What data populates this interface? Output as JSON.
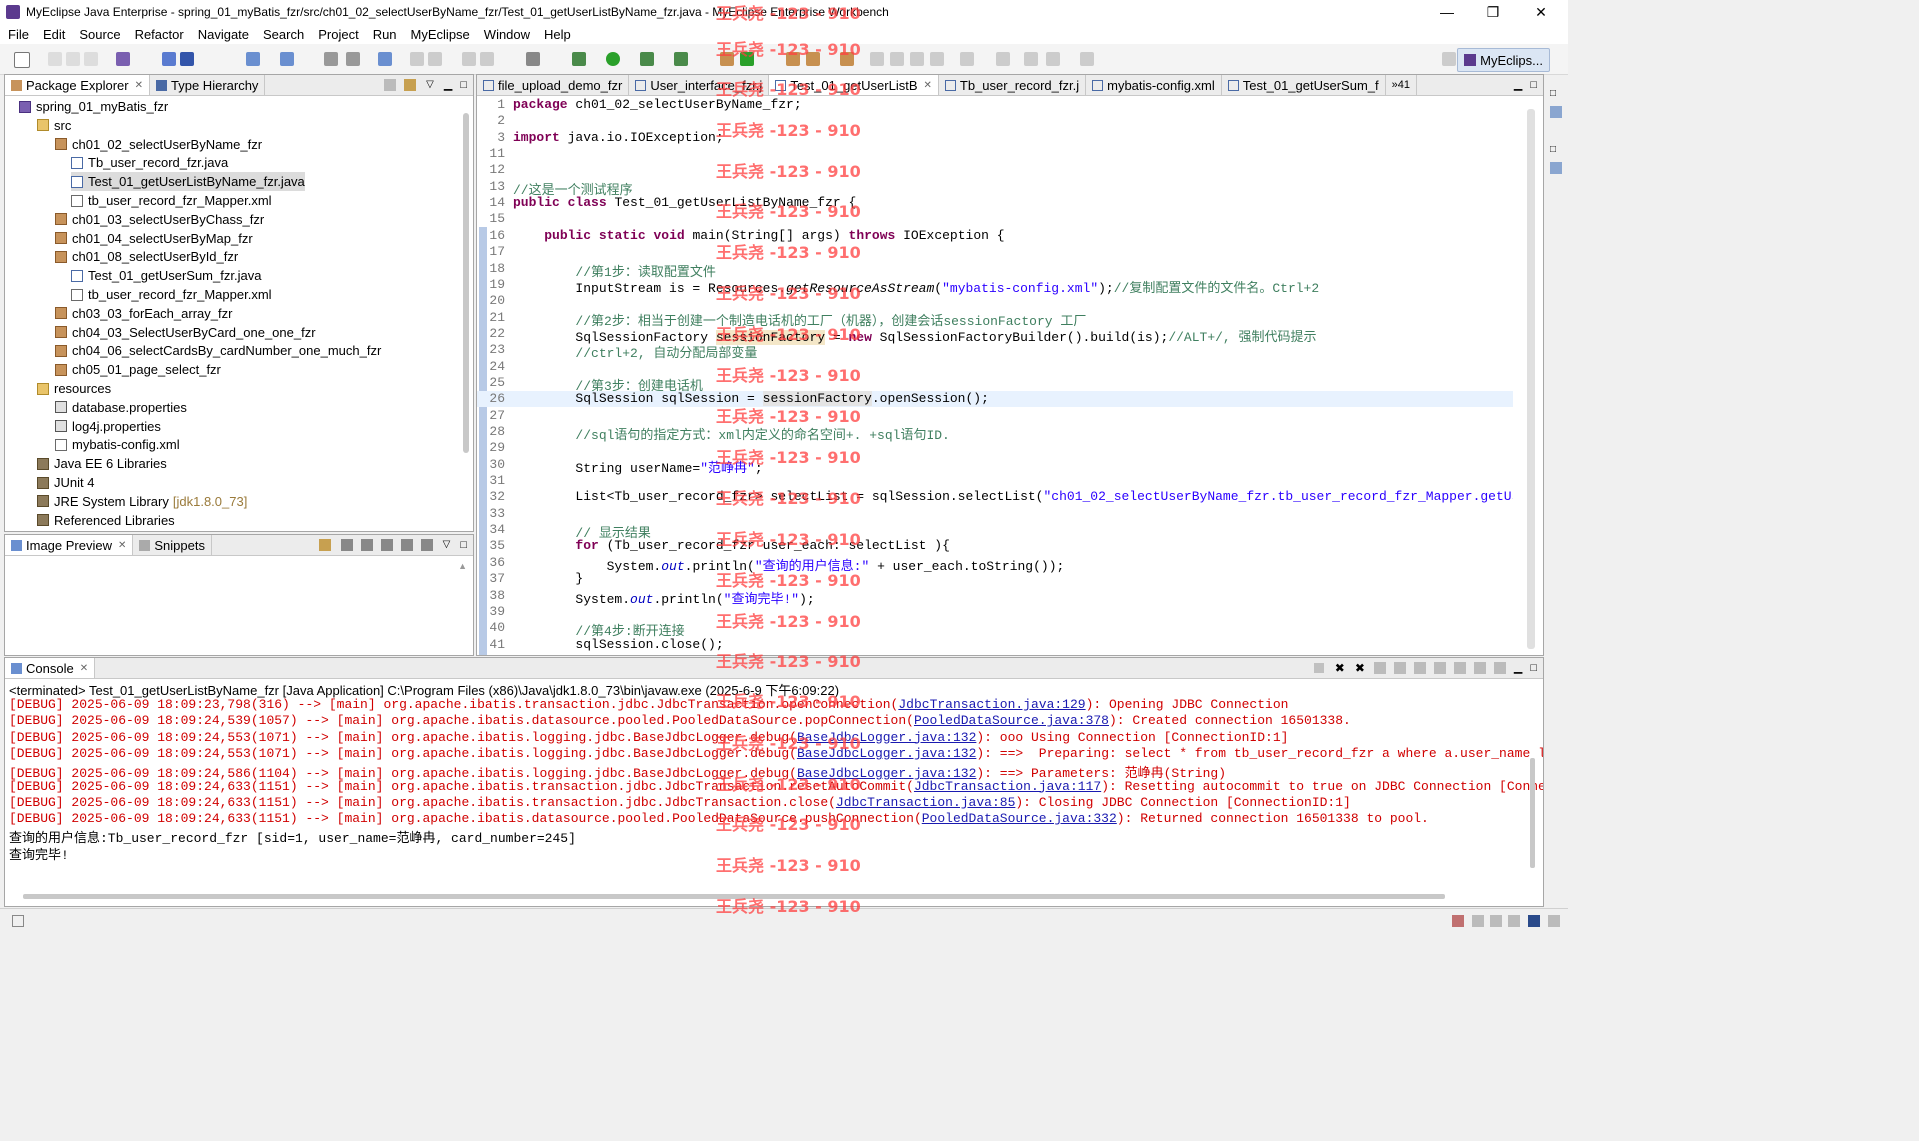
{
  "window": {
    "title": "MyEclipse Java Enterprise - spring_01_myBatis_fzr/src/ch01_02_selectUserByName_fzr/Test_01_getUserListByName_fzr.java - MyEclipse Enterprise Workbench",
    "minimize": "—",
    "maximize": "❐",
    "close": "✕"
  },
  "menu": [
    "File",
    "Edit",
    "Source",
    "Refactor",
    "Navigate",
    "Search",
    "Project",
    "Run",
    "MyEclipse",
    "Window",
    "Help"
  ],
  "perspective": "MyEclips...",
  "package_explorer": {
    "tab": "Package Explorer",
    "tab2": "Type Hierarchy",
    "items": [
      {
        "label": "spring_01_myBatis_fzr",
        "kind": "project",
        "level": 0
      },
      {
        "label": "src",
        "kind": "folder",
        "level": 1
      },
      {
        "label": "ch01_02_selectUserByName_fzr",
        "kind": "package",
        "level": 2
      },
      {
        "label": "Tb_user_record_fzr.java",
        "kind": "java",
        "level": 3
      },
      {
        "label": "Test_01_getUserListByName_fzr.java",
        "kind": "java",
        "level": 3,
        "selected": true
      },
      {
        "label": "tb_user_record_fzr_Mapper.xml",
        "kind": "xml",
        "level": 3
      },
      {
        "label": "ch01_03_selectUserByChass_fzr",
        "kind": "package",
        "level": 2
      },
      {
        "label": "ch01_04_selectUserByMap_fzr",
        "kind": "package",
        "level": 2
      },
      {
        "label": "ch01_08_selectUserById_fzr",
        "kind": "package",
        "level": 2
      },
      {
        "label": "Test_01_getUserSum_fzr.java",
        "kind": "java",
        "level": 3
      },
      {
        "label": "tb_user_record_fzr_Mapper.xml",
        "kind": "xml",
        "level": 3
      },
      {
        "label": "ch03_03_forEach_array_fzr",
        "kind": "package",
        "level": 2
      },
      {
        "label": "ch04_03_SelectUserByCard_one_one_fzr",
        "kind": "package",
        "level": 2
      },
      {
        "label": "ch04_06_selectCardsBy_cardNumber_one_much_fzr",
        "kind": "package",
        "level": 2
      },
      {
        "label": "ch05_01_page_select_fzr",
        "kind": "package",
        "level": 2
      },
      {
        "label": "resources",
        "kind": "folder",
        "level": 1
      },
      {
        "label": "database.properties",
        "kind": "prop",
        "level": 2
      },
      {
        "label": "log4j.properties",
        "kind": "prop",
        "level": 2
      },
      {
        "label": "mybatis-config.xml",
        "kind": "xml",
        "level": 2
      },
      {
        "label": "Java EE 6 Libraries",
        "kind": "lib",
        "level": 1
      },
      {
        "label": "JUnit 4",
        "kind": "lib",
        "level": 1
      },
      {
        "label": "JRE System Library",
        "kind": "lib",
        "level": 1,
        "suffix": "[jdk1.8.0_73]"
      },
      {
        "label": "Referenced Libraries",
        "kind": "lib",
        "level": 1
      }
    ]
  },
  "image_preview": {
    "tab": "Image Preview",
    "tab2": "Snippets"
  },
  "editor": {
    "tabs": [
      {
        "label": "file_upload_demo_fzr"
      },
      {
        "label": "User_interface_fzr.j"
      },
      {
        "label": "Test_01_getUserListB",
        "active": true
      },
      {
        "label": "Tb_user_record_fzr.j"
      },
      {
        "label": "mybatis-config.xml"
      },
      {
        "label": "Test_01_getUserSum_f"
      }
    ],
    "overflow": "»41"
  },
  "console": {
    "tab": "Console",
    "header": "<terminated> Test_01_getUserListByName_fzr [Java Application] C:\\Program Files (x86)\\Java\\jdk1.8.0_73\\bin\\javaw.exe (2025-6-9 下午6:09:22)",
    "result1": "查询的用户信息:Tb_user_record_fzr [sid=1, user_name=范峥冉, card_number=245]",
    "result2": "查询完毕!"
  },
  "watermark": "王兵尧 -123 - 910"
}
